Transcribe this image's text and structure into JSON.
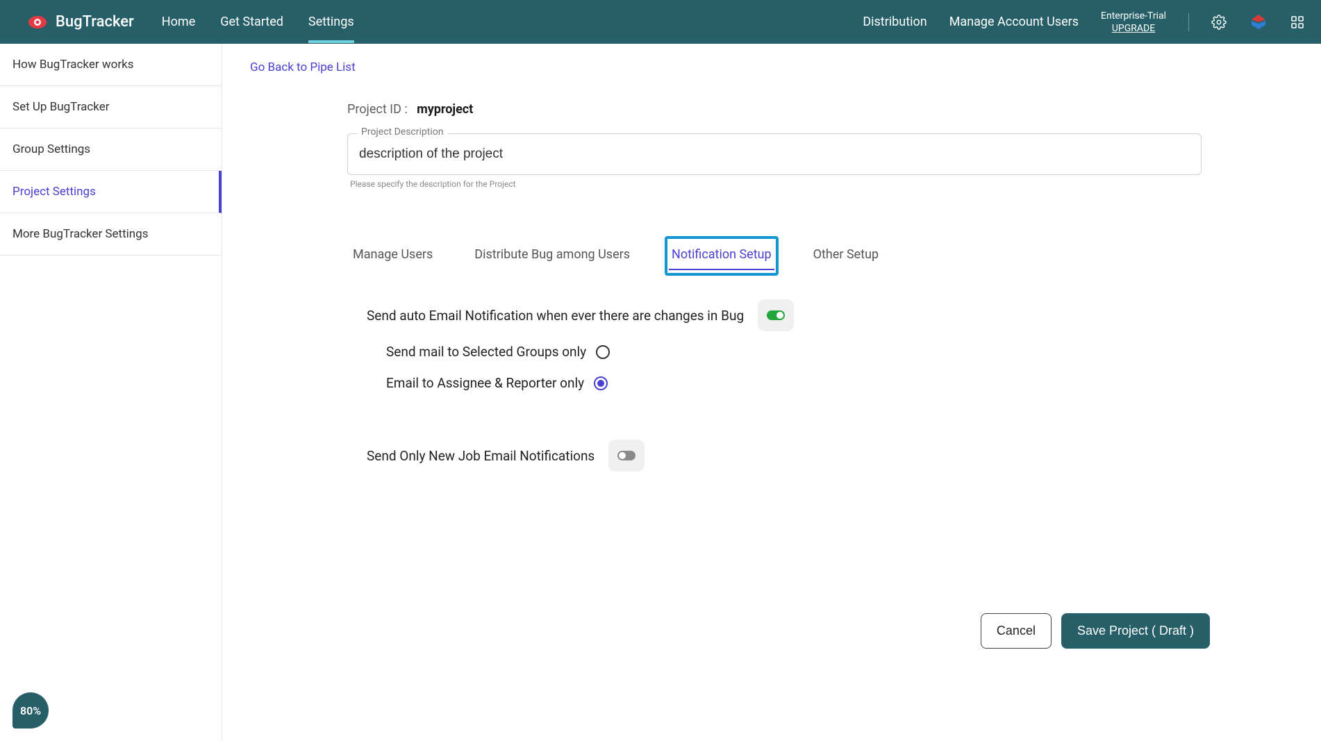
{
  "header": {
    "brand": "BugTracker",
    "nav": [
      "Home",
      "Get Started",
      "Settings"
    ],
    "active_nav_index": 2,
    "right_links": [
      "Distribution",
      "Manage Account Users"
    ],
    "plan_name": "Enterprise-Trial",
    "plan_upgrade": "UPGRADE"
  },
  "sidebar": {
    "items": [
      "How BugTracker works",
      "Set Up BugTracker",
      "Group Settings",
      "Project Settings",
      "More BugTracker Settings"
    ],
    "active_index": 3
  },
  "main": {
    "back_link": "Go Back to Pipe List",
    "project_id_label": "Project ID :",
    "project_id_value": "myproject",
    "description_label": "Project Description",
    "description_value": "description of the project",
    "description_hint": "Please specify the description for the Project",
    "tabs": [
      "Manage Users",
      "Distribute Bug among Users",
      "Notification Setup",
      "Other Setup"
    ],
    "active_tab_index": 2,
    "highlighted_tab_index": 2,
    "settings": {
      "auto_email_label": "Send auto Email Notification when ever there are changes in Bug",
      "auto_email_on": true,
      "radio_options": [
        {
          "label": "Send mail to Selected Groups only",
          "selected": false
        },
        {
          "label": "Email to Assignee & Reporter only",
          "selected": true
        }
      ],
      "new_job_label": "Send Only New Job Email Notifications",
      "new_job_on": false
    },
    "buttons": {
      "cancel": "Cancel",
      "save": "Save Project ( Draft )"
    }
  },
  "progress_chip": "80%"
}
